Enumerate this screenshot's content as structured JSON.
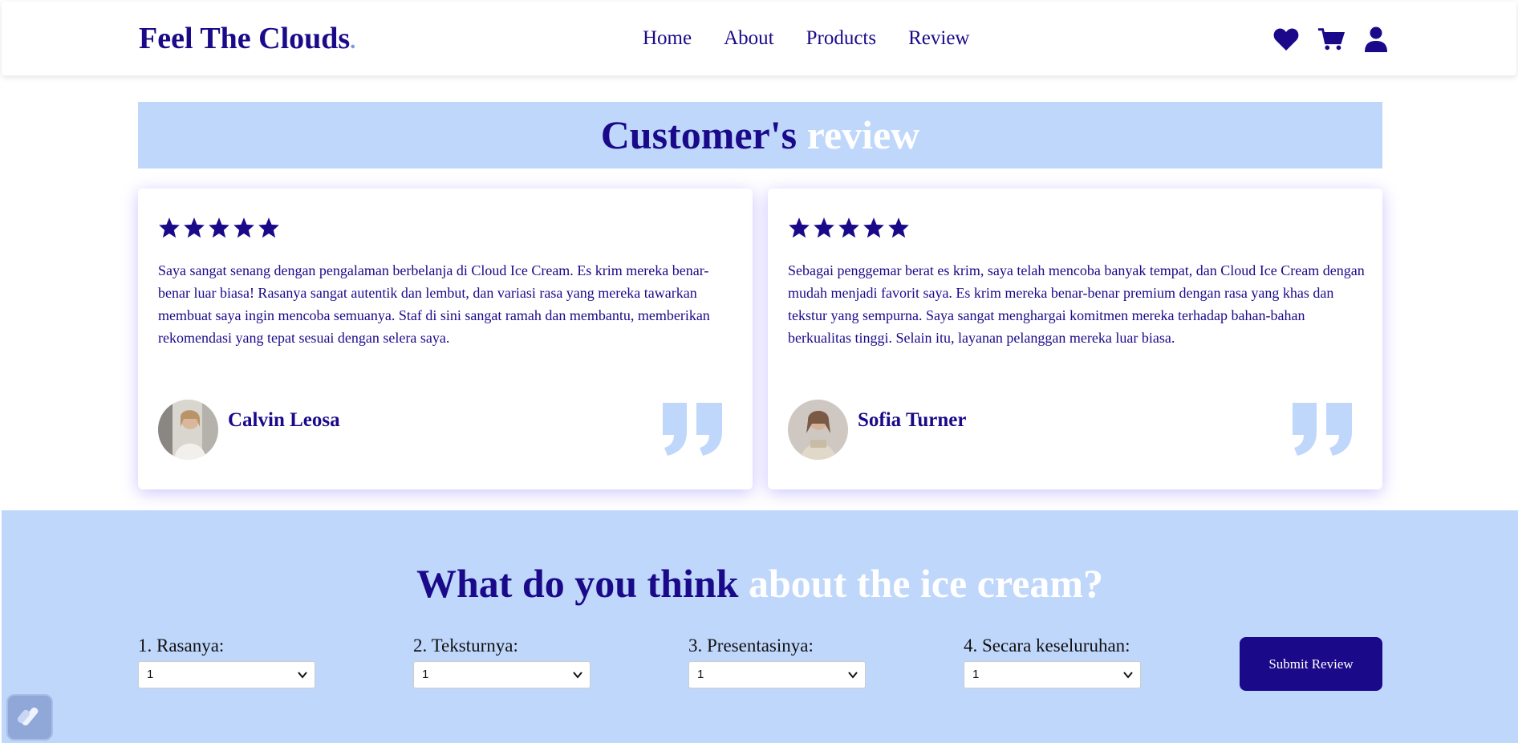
{
  "header": {
    "brand": "Feel The Clouds",
    "brand_dot": ".",
    "nav": [
      "Home",
      "About",
      "Products",
      "Review"
    ],
    "icons": [
      "heart-icon",
      "cart-icon",
      "user-icon"
    ]
  },
  "reviews": {
    "title_dark": "Customer's",
    "title_light": "review",
    "cards": [
      {
        "rating": 5,
        "text": "Saya sangat senang dengan pengalaman berbelanja di Cloud Ice Cream. Es krim mereka benar-benar luar biasa! Rasanya sangat autentik dan lembut, dan variasi rasa yang mereka tawarkan membuat saya ingin mencoba semuanya. Staf di sini sangat ramah dan membantu, memberikan rekomendasi yang tepat sesuai dengan selera saya.",
        "name": "Calvin Leosa"
      },
      {
        "rating": 5,
        "text": "Sebagai penggemar berat es krim, saya telah mencoba banyak tempat, dan Cloud Ice Cream dengan mudah menjadi favorit saya. Es krim mereka benar-benar premium dengan rasa yang khas dan tekstur yang sempurna. Saya sangat menghargai komitmen mereka terhadap bahan-bahan berkualitas tinggi. Selain itu, layanan pelanggan mereka luar biasa.",
        "name": "Sofia Turner"
      }
    ]
  },
  "feedback": {
    "title_dark": "What do you think",
    "title_light": "about the ice cream?",
    "fields": [
      {
        "label": "1. Rasanya:",
        "value": "1"
      },
      {
        "label": "2. Teksturnya:",
        "value": "1"
      },
      {
        "label": "3. Presentasinya:",
        "value": "1"
      },
      {
        "label": "4. Secara keseluruhan:",
        "value": "1"
      }
    ],
    "submit_label": "Submit Review"
  },
  "colors": {
    "primary": "#1a0a8a",
    "light_blue": "#c0d7fc",
    "quote": "#c0d7fc"
  }
}
